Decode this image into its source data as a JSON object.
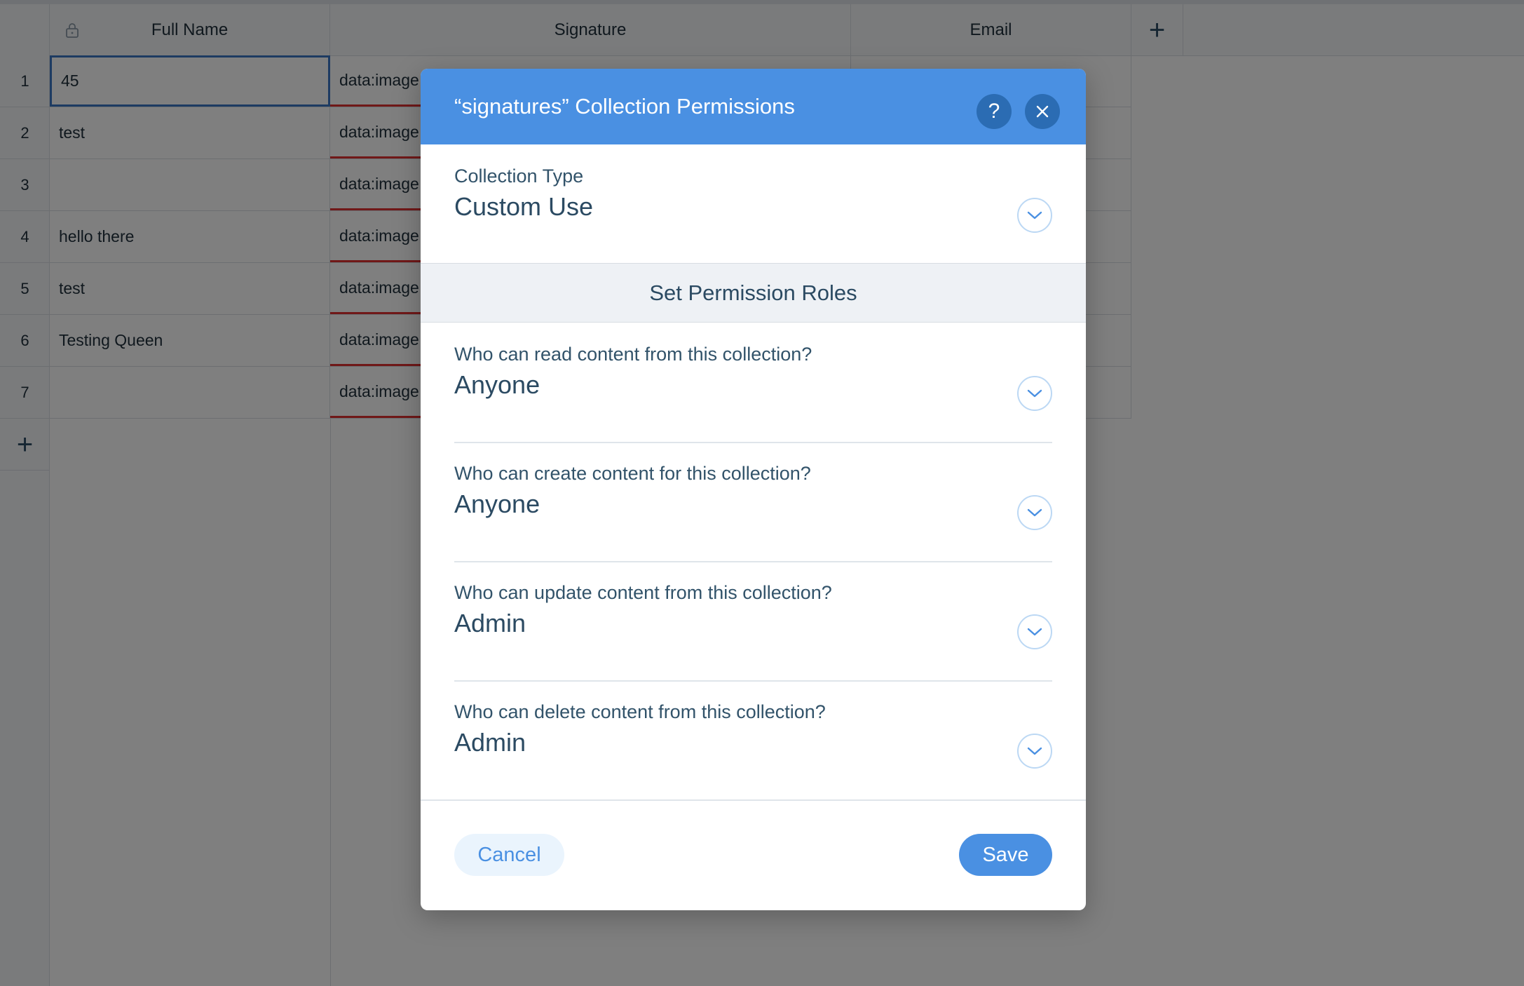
{
  "sheet": {
    "columns": [
      {
        "label": "Full Name"
      },
      {
        "label": "Signature"
      },
      {
        "label": "Email"
      }
    ],
    "rows": [
      {
        "num": "1",
        "full_name": "45",
        "signature": "data:image"
      },
      {
        "num": "2",
        "full_name": "test",
        "signature": "data:image"
      },
      {
        "num": "3",
        "full_name": "",
        "signature": "data:image"
      },
      {
        "num": "4",
        "full_name": "hello there",
        "signature": "data:image"
      },
      {
        "num": "5",
        "full_name": "test",
        "signature": "data:image"
      },
      {
        "num": "6",
        "full_name": "Testing Queen",
        "signature": "data:image"
      },
      {
        "num": "7",
        "full_name": "",
        "signature": "data:image"
      }
    ],
    "add_glyph": "+"
  },
  "modal": {
    "title": "“signatures” Collection Permissions",
    "help_glyph": "?",
    "close_glyph": "×",
    "collection_type": {
      "label": "Collection Type",
      "value": "Custom Use"
    },
    "roles_heading": "Set Permission Roles",
    "permissions": [
      {
        "question": "Who can read content from this collection?",
        "value": "Anyone"
      },
      {
        "question": "Who can create content for this collection?",
        "value": "Anyone"
      },
      {
        "question": "Who can update content from this collection?",
        "value": "Admin"
      },
      {
        "question": "Who can delete content from this collection?",
        "value": "Admin"
      }
    ],
    "cancel_label": "Cancel",
    "save_label": "Save"
  },
  "colors": {
    "accent": "#4a90e2",
    "header_button": "#2b6cb3",
    "text_dark": "#2b4a62",
    "signature_underline": "#e03131"
  }
}
